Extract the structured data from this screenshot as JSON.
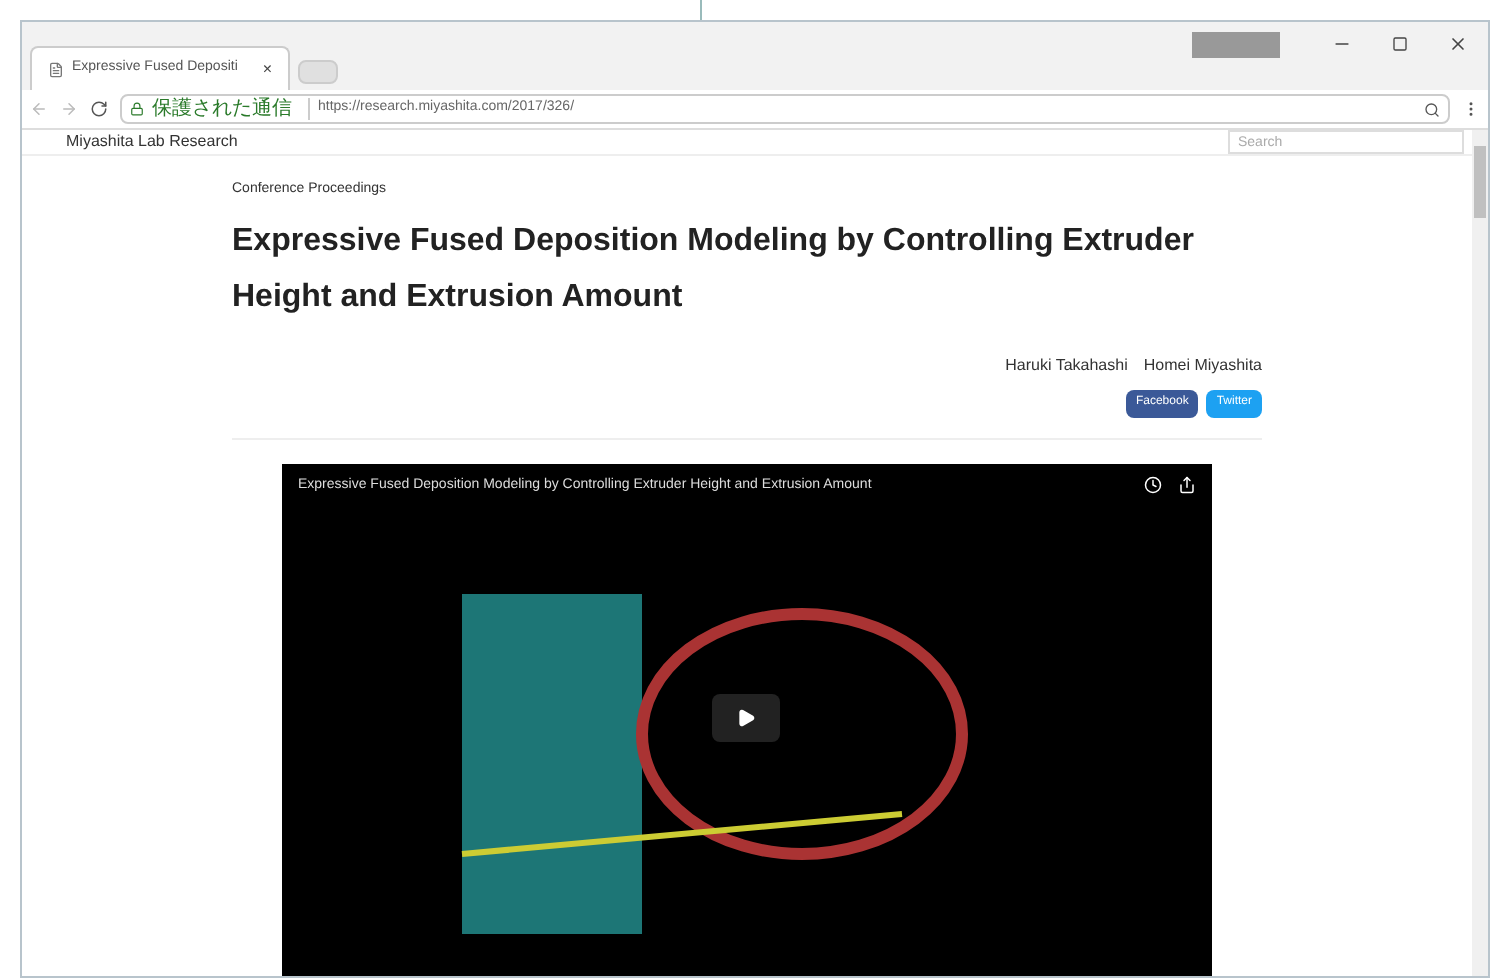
{
  "browser": {
    "tabs": [
      {
        "title": "Expressive Fused Depositi",
        "selected": true,
        "close": "×"
      }
    ],
    "security_label": "保護された通信",
    "url": "https://research.miyashita.com/2017/326/"
  },
  "navbar": {
    "brand": "Miyashita Lab Research",
    "search": {
      "placeholder": "Search"
    }
  },
  "article": {
    "category": "Conference Proceedings",
    "title": "Expressive Fused Deposition Modeling by Controlling Extruder Height and Extrusion Amount",
    "authors": [
      "Haruki Takahashi",
      "Homei Miyashita"
    ],
    "share_buttons": [
      {
        "label": "Facebook",
        "color": "#3b5998"
      },
      {
        "label": "Twitter",
        "color": "#1da1f2"
      }
    ]
  },
  "video": {
    "title": "Expressive Fused Deposition Modeling by Controlling Extruder Height and Extrusion Amount"
  }
}
